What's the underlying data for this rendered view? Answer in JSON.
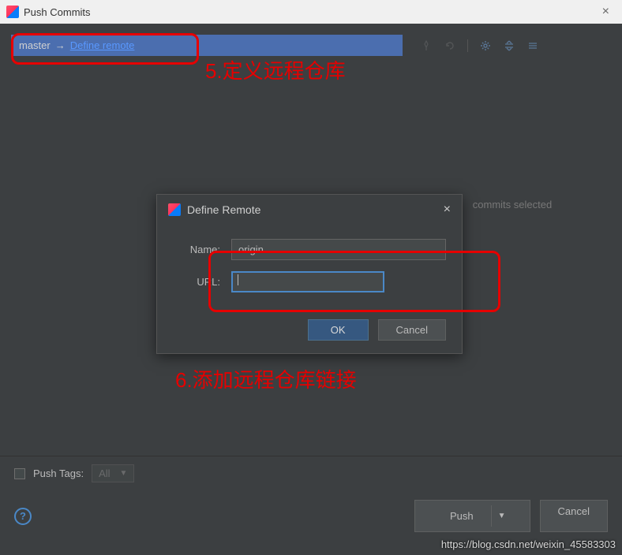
{
  "window": {
    "title": "Push Commits",
    "close": "×"
  },
  "branch": {
    "local": "master",
    "arrow": "→",
    "define_remote": "Define remote"
  },
  "right": {
    "empty_text": "commits selected"
  },
  "push_tags": {
    "label": "Push Tags:",
    "value": "All"
  },
  "buttons": {
    "push": "Push",
    "cancel": "Cancel",
    "help": "?"
  },
  "modal": {
    "title": "Define Remote",
    "close": "×",
    "name_label": "Name:",
    "name_value": "origin",
    "url_label": "URL:",
    "url_value": "",
    "ok": "OK",
    "cancel": "Cancel"
  },
  "annotations": {
    "a5": "5.定义远程仓库",
    "a6": "6.添加远程仓库链接"
  },
  "watermark": "https://blog.csdn.net/weixin_45583303"
}
